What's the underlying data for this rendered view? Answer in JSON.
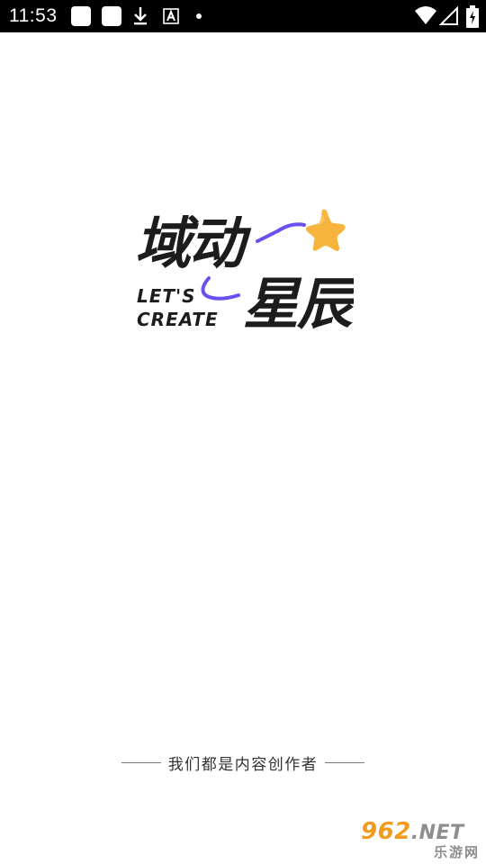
{
  "status_bar": {
    "time": "11:53",
    "icons": [
      "notification-square-icon",
      "notification-square-icon",
      "download-icon",
      "font-a-icon",
      "dot-icon",
      "wifi-icon",
      "signal-icon",
      "battery-charging-icon"
    ]
  },
  "logo": {
    "line1": "域动",
    "line2": "星辰",
    "en_line1": "LET'S",
    "en_line2": "CREATE",
    "star_color": "#f6b43c",
    "accent_color": "#6b4ff0"
  },
  "tagline": "我们都是内容创作者",
  "watermark": {
    "brand": "962",
    "domain": ".NET",
    "subtitle": "乐游网"
  }
}
